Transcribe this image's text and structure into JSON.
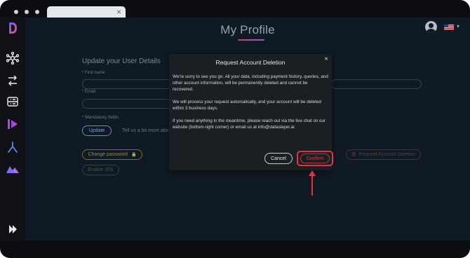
{
  "browser": {
    "tab_close": "×"
  },
  "sidebar": {
    "items": [
      {
        "icon": "logo-d-icon"
      },
      {
        "icon": "hub-icon"
      },
      {
        "icon": "transfer-icon"
      },
      {
        "icon": "data-table-icon"
      },
      {
        "icon": "looker-icon"
      },
      {
        "icon": "split-icon"
      },
      {
        "icon": "mountain-icon"
      },
      {
        "icon": "expand-sidebar-icon"
      }
    ]
  },
  "header": {
    "page_title": "My Profile",
    "language_flag": "us-flag-icon",
    "caret": "▾"
  },
  "profile": {
    "section_title": "Update your User Details",
    "first_name_label": "* First name",
    "email_label": "* Email",
    "mandatory_note": "* Mandatory fields",
    "update_label": "Update",
    "tell_us": "Tell us a bit more abo",
    "change_password_label": "Change password",
    "lock_icon": "🔒",
    "enable_2fa_label": "Enable 2FA",
    "request_deletion_label": "Request Account Deletion"
  },
  "modal": {
    "title": "Request Account Deletion",
    "close": "×",
    "paragraph1": "We're sorry to see you go. All your data, including payment history, queries, and other account information, will be permanently deleted and cannot be recovered.",
    "paragraph2": "We will process your request automatically, and your account will be deleted within 3 business days.",
    "paragraph3": "If you need anything in the meantime, please reach out via the live chat on our website (bottom-right corner) or email us at info@dataslayer.ai",
    "cancel_label": "Cancel",
    "confirm_label": "Confirm"
  },
  "colors": {
    "accent_red": "#e0333f",
    "accent_gold": "#c99a2e",
    "accent_green": "#3e7a3c"
  }
}
